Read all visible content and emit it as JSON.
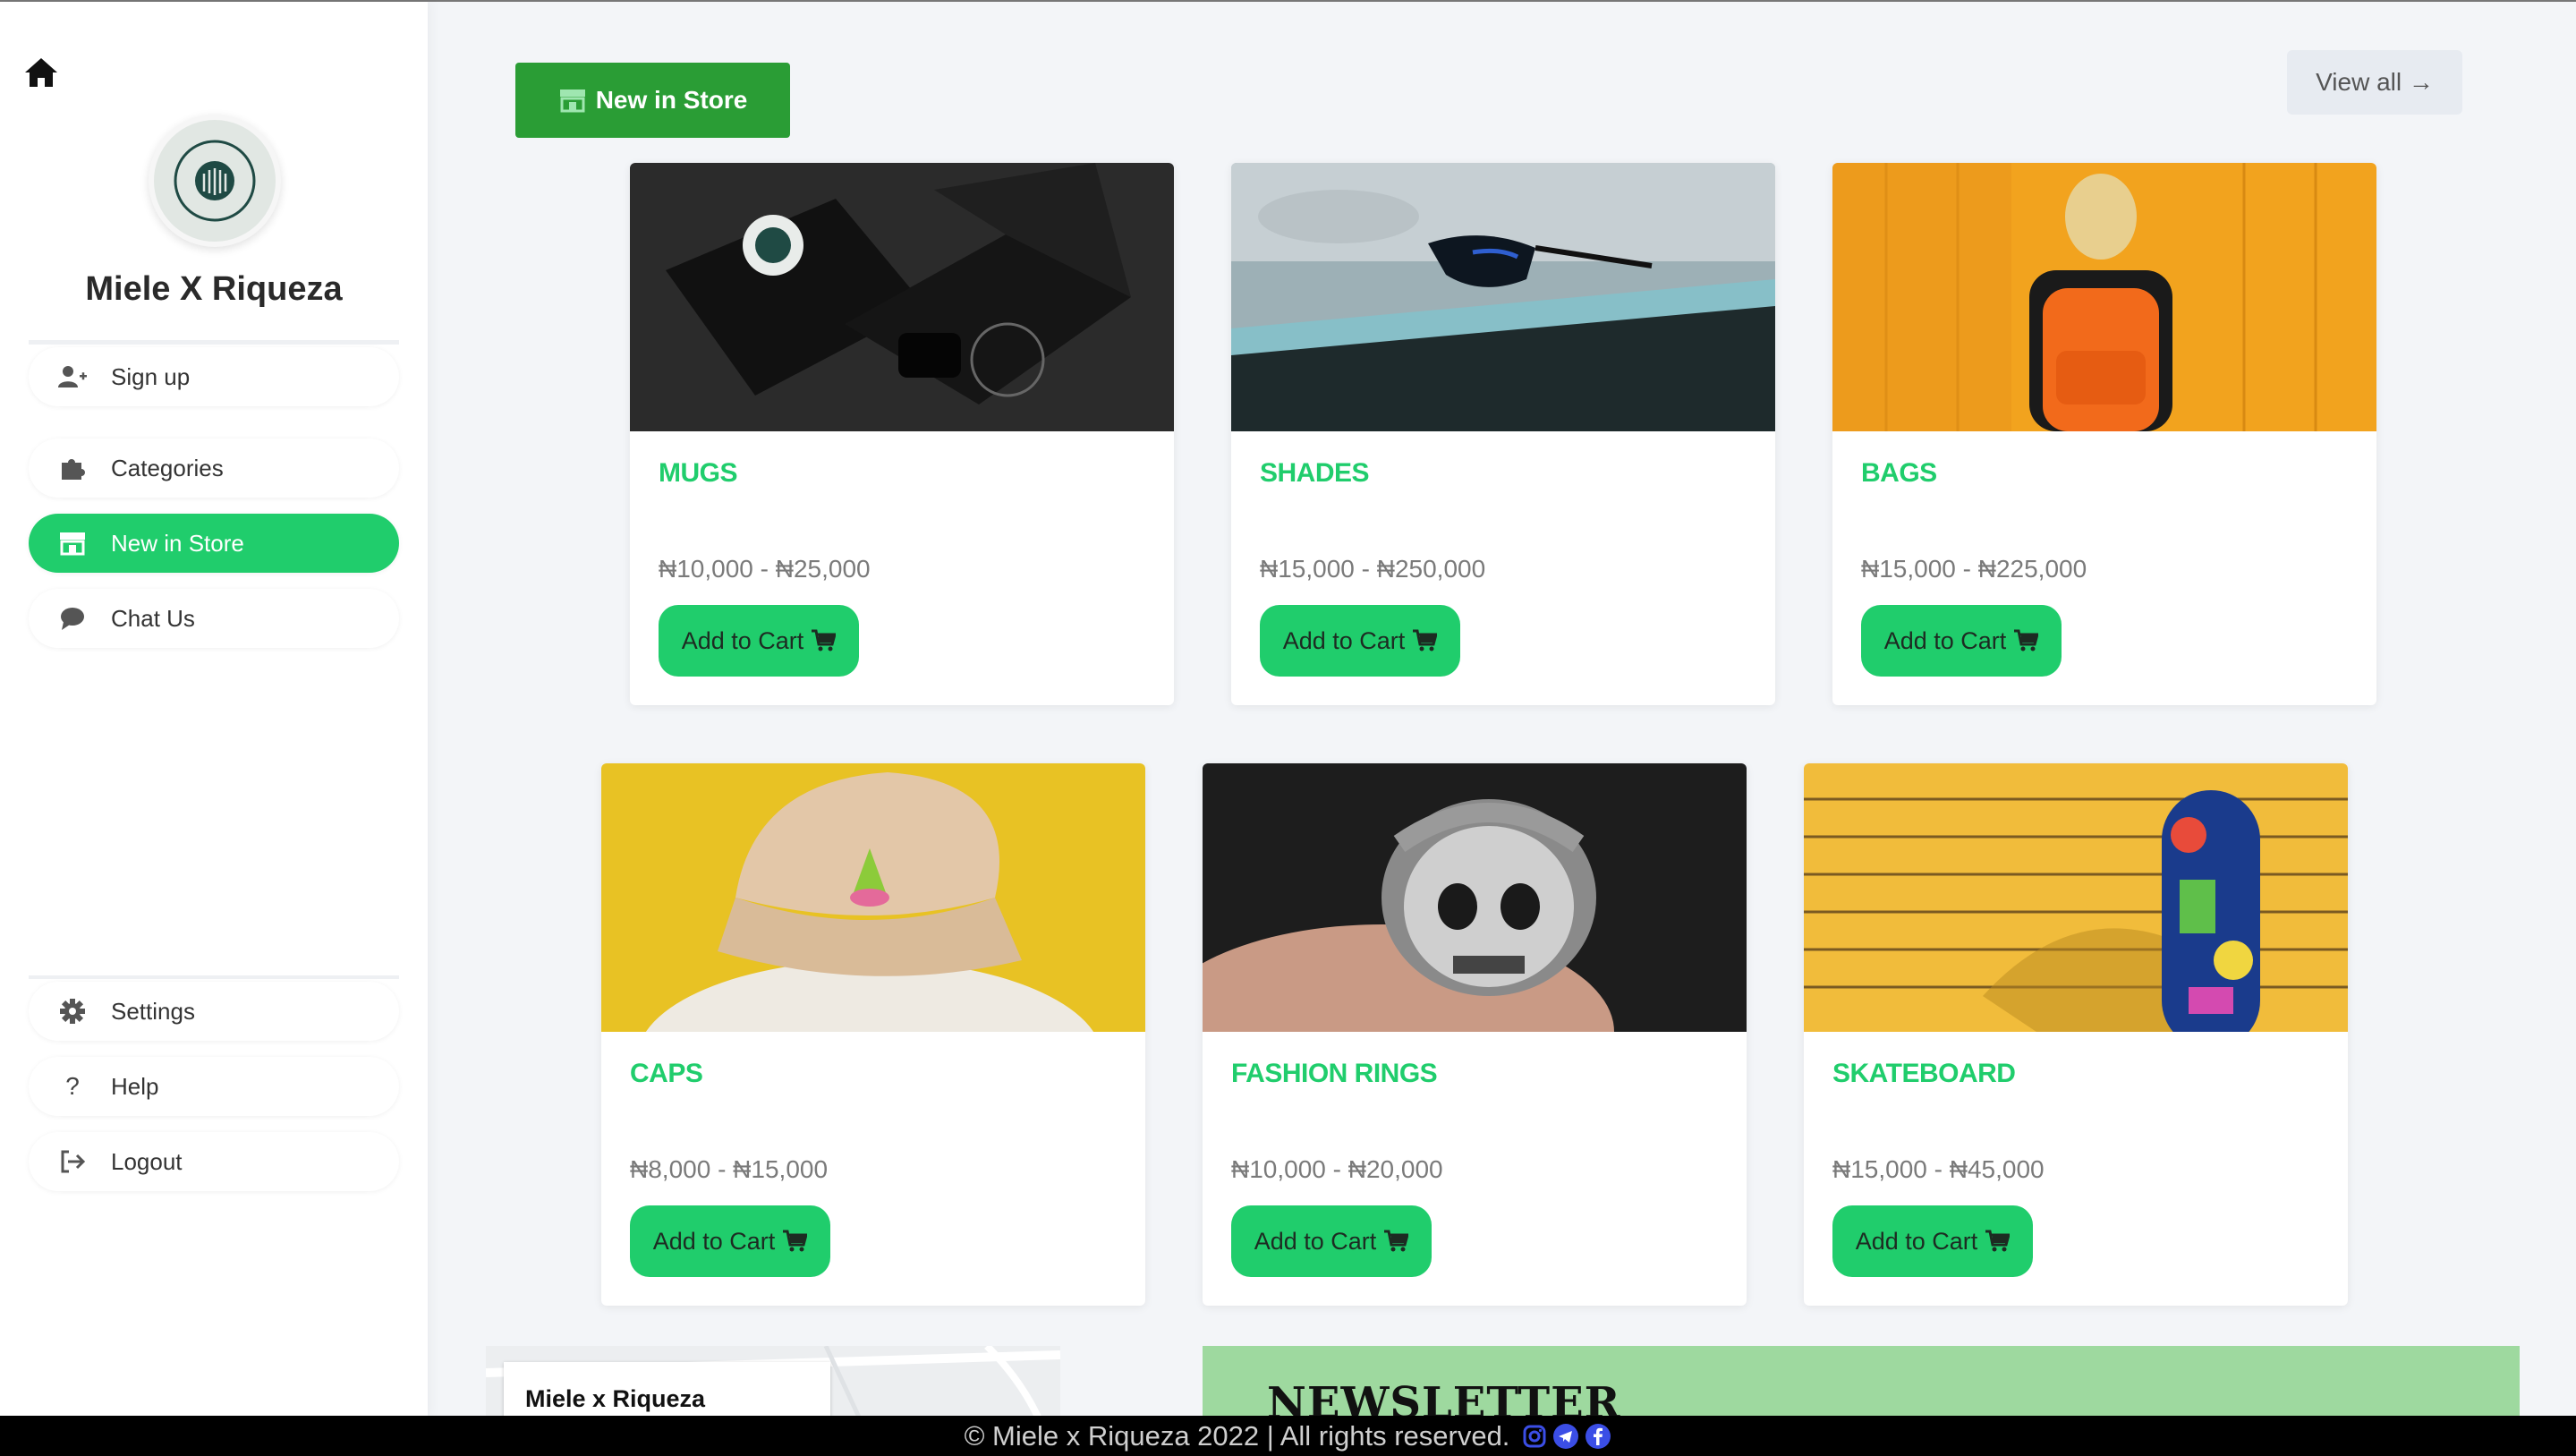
{
  "sidebar": {
    "brand_name": "Miele X Riqueza",
    "top_items": [
      {
        "label": "Sign up",
        "icon": "user-plus-icon"
      },
      {
        "label": "Categories",
        "icon": "puzzle-icon"
      },
      {
        "label": "New in Store",
        "icon": "store-icon",
        "active": true
      },
      {
        "label": "Chat Us",
        "icon": "chat-bubble-icon"
      }
    ],
    "bottom_items": [
      {
        "label": "Settings",
        "icon": "gear-icon"
      },
      {
        "label": "Help",
        "icon": "question-icon"
      },
      {
        "label": "Logout",
        "icon": "logout-icon"
      }
    ]
  },
  "main": {
    "store_button": "New in Store",
    "view_all": "View all →",
    "products": [
      {
        "title": "MUGS",
        "price": "₦10,000 - ₦25,000",
        "cart": "Add to Cart"
      },
      {
        "title": "SHADES",
        "price": "₦15,000 - ₦250,000",
        "cart": "Add to Cart"
      },
      {
        "title": "BAGS",
        "price": "₦15,000 - ₦225,000",
        "cart": "Add to Cart"
      },
      {
        "title": "CAPS",
        "price": "₦8,000 - ₦15,000",
        "cart": "Add to Cart"
      },
      {
        "title": "FASHION RINGS",
        "price": "₦10,000 - ₦20,000",
        "cart": "Add to Cart"
      },
      {
        "title": "SKATEBOARD",
        "price": "₦15,000 - ₦45,000",
        "cart": "Add to Cart"
      }
    ],
    "map_label": "Miele x Riqueza",
    "newsletter_title": "NEWSLETTER"
  },
  "footer": {
    "text": "© Miele x Riqueza 2022 | All rights reserved.",
    "social_icons": [
      "instagram-icon",
      "telegram-icon",
      "facebook-icon"
    ]
  },
  "colors": {
    "accent_green": "#20cd6c",
    "store_button_green": "#2a9d35",
    "newsletter_green": "#9ed99f"
  }
}
